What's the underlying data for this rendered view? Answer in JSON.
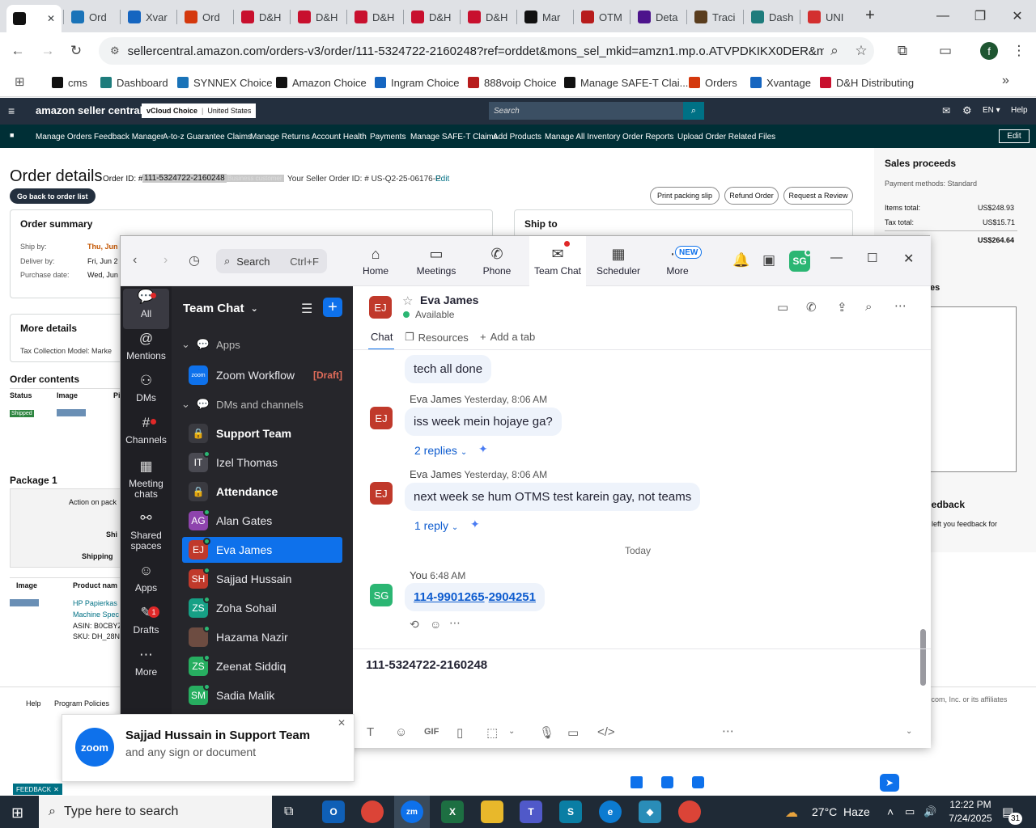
{
  "browser": {
    "tabs": [
      {
        "label": "",
        "icon": "amazon-icon",
        "color": "#111111"
      },
      {
        "label": "Ord",
        "icon": "synnex-icon",
        "color": "#1a73b8"
      },
      {
        "label": "Xvar",
        "icon": "xvantage-icon",
        "color": "#1565c0"
      },
      {
        "label": "Ord",
        "icon": "orders-icon",
        "color": "#d4380d"
      },
      {
        "label": "D&H",
        "icon": "dh-icon",
        "color": "#c8102e"
      },
      {
        "label": "D&H",
        "icon": "dh-icon",
        "color": "#c8102e"
      },
      {
        "label": "D&H",
        "icon": "dh-icon",
        "color": "#c8102e"
      },
      {
        "label": "D&H",
        "icon": "dh-icon",
        "color": "#c8102e"
      },
      {
        "label": "D&H",
        "icon": "dh-icon",
        "color": "#c8102e"
      },
      {
        "label": "Mar",
        "icon": "amazon-icon",
        "color": "#111111"
      },
      {
        "label": "OTM",
        "icon": "otm-icon",
        "color": "#b71c1c"
      },
      {
        "label": "Deta",
        "icon": "fedex-icon",
        "color": "#4d148c"
      },
      {
        "label": "Traci",
        "icon": "ups-icon",
        "color": "#5a3d1e"
      },
      {
        "label": "Dash",
        "icon": "dashboard-icon",
        "color": "#1e7c7c"
      },
      {
        "label": "UNI",
        "icon": "uni-icon",
        "color": "#d32f2f"
      }
    ],
    "url": "sellercentral.amazon.com/orders-v3/order/111-5324722-2160248?ref=orddet&mons_sel_mkid=amzn1.mp.o.ATVPDKIKX0DER&mons_sel...",
    "profile_initial": "f",
    "bookmarks": [
      {
        "label": "cms",
        "color": "#111111"
      },
      {
        "label": "Dashboard",
        "color": "#1e7c7c"
      },
      {
        "label": "SYNNEX Choice",
        "color": "#1a73b8"
      },
      {
        "label": "Amazon Choice",
        "color": "#111111"
      },
      {
        "label": "Ingram Choice",
        "color": "#1565c0"
      },
      {
        "label": "888voip Choice",
        "color": "#b71c1c"
      },
      {
        "label": "Manage SAFE-T Clai...",
        "color": "#111111"
      },
      {
        "label": "Orders",
        "color": "#d4380d"
      },
      {
        "label": "Xvantage",
        "color": "#1565c0"
      },
      {
        "label": "D&H Distributing",
        "color": "#c8102e"
      }
    ]
  },
  "amazon": {
    "logo": "amazon seller central",
    "store": "vCloud Choice",
    "region": "United States",
    "search_placeholder": "Search",
    "lang": "EN",
    "help": "Help",
    "nav": [
      "Manage Orders",
      "Feedback Manager",
      "A-to-z Guarantee Claims",
      "Manage Returns",
      "Account Health",
      "Payments",
      "Manage SAFE-T Claims",
      "Add Products",
      "Manage All Inventory",
      "Order Reports",
      "Upload Order Related Files"
    ],
    "nav_edit": "Edit",
    "page_title": "Order details",
    "order_id_label": "Order ID: #",
    "order_id": "111-5324722-2160248",
    "business_badge": "Business customer",
    "seller_order_label": "Your Seller Order ID: # US-Q2-25-06176-P",
    "seller_order_edit": "Edit",
    "back_button": "Go back to order list",
    "buttons": [
      "Print packing slip",
      "Refund Order",
      "Request a Review"
    ],
    "order_summary": "Order summary",
    "ship_by_label": "Ship by:",
    "ship_by_value": "Thu, Jun",
    "deliver_by_label": "Deliver by:",
    "deliver_by_value": "Fri, Jun 2",
    "purchase_label": "Purchase date:",
    "purchase_value": "Wed, Jun",
    "ship_to": "Ship to",
    "more_details": "More details",
    "tax_model": "Tax Collection Model: Marke",
    "order_contents": "Order contents",
    "col_status": "Status",
    "col_image": "Image",
    "col_p": "Pi",
    "status_badge": "Shipped",
    "package": "Package 1",
    "action_on": "Action on pack",
    "ship_frag": "Shi",
    "shipping_frag": "Shipping",
    "image_col": "Image",
    "product_col": "Product nam",
    "product_name1": "HP Papierkas",
    "product_name2": "Machine Spec",
    "asin": "ASIN: B0CBYZ",
    "sku": "SKU: DH_28N",
    "sales_proceeds": "Sales proceeds",
    "payment_methods": "Payment methods: Standard",
    "items_total_label": "Items total:",
    "items_total": "US$248.93",
    "tax_total_label": "Tax total:",
    "tax_total": "US$15.71",
    "grand_total": "US$264.64",
    "notes_frag": "es",
    "feedback_frag": "eedback",
    "feedback_text": "left you feedback for",
    "footer_help": "Help",
    "footer_policies": "Program Policies",
    "footer_copy": ".com, Inc. or its affiliates",
    "feedback_tab": "FEEDBACK"
  },
  "zoom": {
    "search_label": "Search",
    "search_shortcut": "Ctrl+F",
    "tabs": [
      {
        "label": "Home",
        "icon": "home-icon"
      },
      {
        "label": "Meetings",
        "icon": "video-icon"
      },
      {
        "label": "Phone",
        "icon": "phone-icon"
      },
      {
        "label": "Team Chat",
        "icon": "chat-icon"
      },
      {
        "label": "Scheduler",
        "icon": "calendar-icon"
      },
      {
        "label": "More",
        "icon": "more-icon"
      }
    ],
    "new_badge": "NEW",
    "user_initials": "SG",
    "rail": [
      {
        "label": "All",
        "icon": "chat-bubble-icon"
      },
      {
        "label": "Mentions",
        "icon": "at-icon"
      },
      {
        "label": "DMs",
        "icon": "people-icon"
      },
      {
        "label": "Channels",
        "icon": "hash-icon"
      },
      {
        "label": "Meeting chats",
        "icon": "calendar-icon"
      },
      {
        "label": "Shared spaces",
        "icon": "share-icon"
      },
      {
        "label": "Apps",
        "icon": "apps-icon"
      },
      {
        "label": "Drafts",
        "icon": "draft-icon",
        "badge": "1"
      },
      {
        "label": "More",
        "icon": "more-icon"
      }
    ],
    "list_title": "Team Chat",
    "section_apps": "Apps",
    "app_item": "Zoom Workflow",
    "draft_tag": "[Draft]",
    "section_dms": "DMs and channels",
    "contacts": [
      {
        "name": "Support Team",
        "initials": "",
        "color": "#3a3a40",
        "bold": true,
        "lock": true
      },
      {
        "name": "Izel Thomas",
        "initials": "IT",
        "color": "#4a4a52",
        "bold": false,
        "lock": false
      },
      {
        "name": "Attendance",
        "initials": "",
        "color": "#3a3a40",
        "bold": true,
        "lock": true
      },
      {
        "name": "Alan Gates",
        "initials": "AG",
        "color": "#8e44ad",
        "bold": false,
        "lock": false
      },
      {
        "name": "Eva James",
        "initials": "EJ",
        "color": "#c0392b",
        "bold": false,
        "lock": false
      },
      {
        "name": "Sajjad Hussain",
        "initials": "SH",
        "color": "#c0392b",
        "bold": false,
        "lock": false
      },
      {
        "name": "Zoha Sohail",
        "initials": "ZS",
        "color": "#16a085",
        "bold": false,
        "lock": false
      },
      {
        "name": "Hazama Nazir",
        "initials": "",
        "color": "#6d4c41",
        "bold": false,
        "lock": false
      },
      {
        "name": "Zeenat Siddiq",
        "initials": "ZS",
        "color": "#27ae60",
        "bold": false,
        "lock": false
      },
      {
        "name": "Sadia Malik",
        "initials": "SM",
        "color": "#27ae60",
        "bold": false,
        "lock": false
      }
    ],
    "chat_name": "Eva James",
    "chat_initials": "EJ",
    "chat_status": "Available",
    "chat_tabs": [
      "Chat",
      "Resources",
      "Add a tab"
    ],
    "messages": {
      "m0": "tech all done",
      "m1_sender": "Eva James",
      "m1_time": "Yesterday, 8:06 AM",
      "m1": "iss week mein hojaye ga?",
      "m1_replies": "2 replies",
      "m2_sender": "Eva James",
      "m2_time": "Yesterday, 8:06 AM",
      "m2": "next week se hum OTMS test karein gay, not teams",
      "m2_replies": "1 reply",
      "divider": "Today",
      "m3_sender": "You",
      "m3_time": "6:48 AM",
      "m3_part1": "114-9901265",
      "m3_dash": "-",
      "m3_part2": "2904251",
      "my_initials": "SG"
    },
    "composer_text": "111-5324722-2160248"
  },
  "notification": {
    "logo": "zoom",
    "title": "Sajjad Hussain in Support Team",
    "body": "and any sign or document"
  },
  "taskbar": {
    "search_placeholder": "Type here to search",
    "weather": "27°C  Haze",
    "time": "12:22 PM",
    "date": "7/24/2025",
    "notif_count": "31"
  }
}
